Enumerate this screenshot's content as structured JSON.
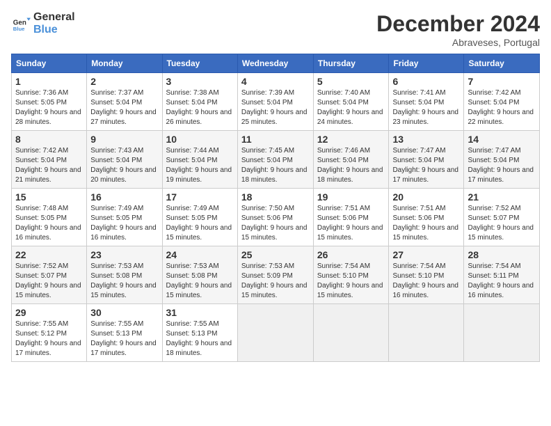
{
  "logo": {
    "line1": "General",
    "line2": "Blue"
  },
  "title": "December 2024",
  "location": "Abraveses, Portugal",
  "days_header": [
    "Sunday",
    "Monday",
    "Tuesday",
    "Wednesday",
    "Thursday",
    "Friday",
    "Saturday"
  ],
  "weeks": [
    [
      {
        "day": "1",
        "sunrise": "Sunrise: 7:36 AM",
        "sunset": "Sunset: 5:05 PM",
        "daylight": "Daylight: 9 hours and 28 minutes."
      },
      {
        "day": "2",
        "sunrise": "Sunrise: 7:37 AM",
        "sunset": "Sunset: 5:04 PM",
        "daylight": "Daylight: 9 hours and 27 minutes."
      },
      {
        "day": "3",
        "sunrise": "Sunrise: 7:38 AM",
        "sunset": "Sunset: 5:04 PM",
        "daylight": "Daylight: 9 hours and 26 minutes."
      },
      {
        "day": "4",
        "sunrise": "Sunrise: 7:39 AM",
        "sunset": "Sunset: 5:04 PM",
        "daylight": "Daylight: 9 hours and 25 minutes."
      },
      {
        "day": "5",
        "sunrise": "Sunrise: 7:40 AM",
        "sunset": "Sunset: 5:04 PM",
        "daylight": "Daylight: 9 hours and 24 minutes."
      },
      {
        "day": "6",
        "sunrise": "Sunrise: 7:41 AM",
        "sunset": "Sunset: 5:04 PM",
        "daylight": "Daylight: 9 hours and 23 minutes."
      },
      {
        "day": "7",
        "sunrise": "Sunrise: 7:42 AM",
        "sunset": "Sunset: 5:04 PM",
        "daylight": "Daylight: 9 hours and 22 minutes."
      }
    ],
    [
      {
        "day": "8",
        "sunrise": "Sunrise: 7:42 AM",
        "sunset": "Sunset: 5:04 PM",
        "daylight": "Daylight: 9 hours and 21 minutes."
      },
      {
        "day": "9",
        "sunrise": "Sunrise: 7:43 AM",
        "sunset": "Sunset: 5:04 PM",
        "daylight": "Daylight: 9 hours and 20 minutes."
      },
      {
        "day": "10",
        "sunrise": "Sunrise: 7:44 AM",
        "sunset": "Sunset: 5:04 PM",
        "daylight": "Daylight: 9 hours and 19 minutes."
      },
      {
        "day": "11",
        "sunrise": "Sunrise: 7:45 AM",
        "sunset": "Sunset: 5:04 PM",
        "daylight": "Daylight: 9 hours and 18 minutes."
      },
      {
        "day": "12",
        "sunrise": "Sunrise: 7:46 AM",
        "sunset": "Sunset: 5:04 PM",
        "daylight": "Daylight: 9 hours and 18 minutes."
      },
      {
        "day": "13",
        "sunrise": "Sunrise: 7:47 AM",
        "sunset": "Sunset: 5:04 PM",
        "daylight": "Daylight: 9 hours and 17 minutes."
      },
      {
        "day": "14",
        "sunrise": "Sunrise: 7:47 AM",
        "sunset": "Sunset: 5:04 PM",
        "daylight": "Daylight: 9 hours and 17 minutes."
      }
    ],
    [
      {
        "day": "15",
        "sunrise": "Sunrise: 7:48 AM",
        "sunset": "Sunset: 5:05 PM",
        "daylight": "Daylight: 9 hours and 16 minutes."
      },
      {
        "day": "16",
        "sunrise": "Sunrise: 7:49 AM",
        "sunset": "Sunset: 5:05 PM",
        "daylight": "Daylight: 9 hours and 16 minutes."
      },
      {
        "day": "17",
        "sunrise": "Sunrise: 7:49 AM",
        "sunset": "Sunset: 5:05 PM",
        "daylight": "Daylight: 9 hours and 15 minutes."
      },
      {
        "day": "18",
        "sunrise": "Sunrise: 7:50 AM",
        "sunset": "Sunset: 5:06 PM",
        "daylight": "Daylight: 9 hours and 15 minutes."
      },
      {
        "day": "19",
        "sunrise": "Sunrise: 7:51 AM",
        "sunset": "Sunset: 5:06 PM",
        "daylight": "Daylight: 9 hours and 15 minutes."
      },
      {
        "day": "20",
        "sunrise": "Sunrise: 7:51 AM",
        "sunset": "Sunset: 5:06 PM",
        "daylight": "Daylight: 9 hours and 15 minutes."
      },
      {
        "day": "21",
        "sunrise": "Sunrise: 7:52 AM",
        "sunset": "Sunset: 5:07 PM",
        "daylight": "Daylight: 9 hours and 15 minutes."
      }
    ],
    [
      {
        "day": "22",
        "sunrise": "Sunrise: 7:52 AM",
        "sunset": "Sunset: 5:07 PM",
        "daylight": "Daylight: 9 hours and 15 minutes."
      },
      {
        "day": "23",
        "sunrise": "Sunrise: 7:53 AM",
        "sunset": "Sunset: 5:08 PM",
        "daylight": "Daylight: 9 hours and 15 minutes."
      },
      {
        "day": "24",
        "sunrise": "Sunrise: 7:53 AM",
        "sunset": "Sunset: 5:08 PM",
        "daylight": "Daylight: 9 hours and 15 minutes."
      },
      {
        "day": "25",
        "sunrise": "Sunrise: 7:53 AM",
        "sunset": "Sunset: 5:09 PM",
        "daylight": "Daylight: 9 hours and 15 minutes."
      },
      {
        "day": "26",
        "sunrise": "Sunrise: 7:54 AM",
        "sunset": "Sunset: 5:10 PM",
        "daylight": "Daylight: 9 hours and 15 minutes."
      },
      {
        "day": "27",
        "sunrise": "Sunrise: 7:54 AM",
        "sunset": "Sunset: 5:10 PM",
        "daylight": "Daylight: 9 hours and 16 minutes."
      },
      {
        "day": "28",
        "sunrise": "Sunrise: 7:54 AM",
        "sunset": "Sunset: 5:11 PM",
        "daylight": "Daylight: 9 hours and 16 minutes."
      }
    ],
    [
      {
        "day": "29",
        "sunrise": "Sunrise: 7:55 AM",
        "sunset": "Sunset: 5:12 PM",
        "daylight": "Daylight: 9 hours and 17 minutes."
      },
      {
        "day": "30",
        "sunrise": "Sunrise: 7:55 AM",
        "sunset": "Sunset: 5:13 PM",
        "daylight": "Daylight: 9 hours and 17 minutes."
      },
      {
        "day": "31",
        "sunrise": "Sunrise: 7:55 AM",
        "sunset": "Sunset: 5:13 PM",
        "daylight": "Daylight: 9 hours and 18 minutes."
      },
      null,
      null,
      null,
      null
    ]
  ]
}
